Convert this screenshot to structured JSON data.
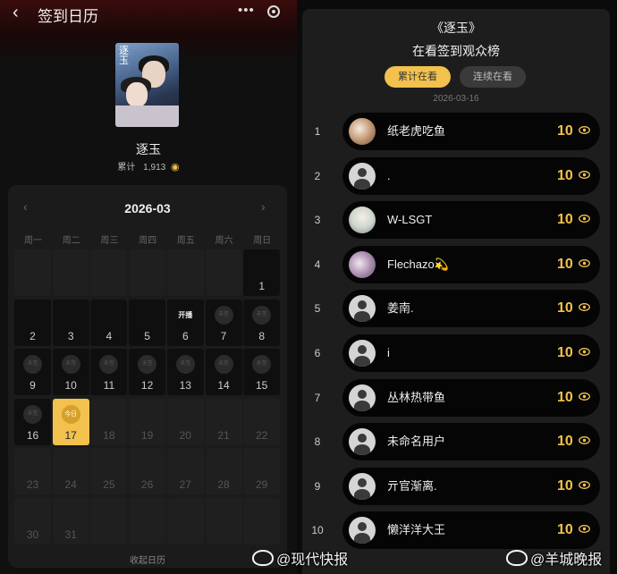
{
  "header": {
    "back_icon": "chevron-left-icon",
    "title": "签到日历",
    "more_icon": "more-dots-icon",
    "target_icon": "target-icon"
  },
  "drama": {
    "name": "逐玉",
    "poster_title": "逐玉",
    "cumulative_label": "累计",
    "cumulative_value": "1,913",
    "eye_icon": "eye-icon"
  },
  "calendar": {
    "month": "2026-03",
    "prev_icon": "chevron-left-icon",
    "next_icon": "chevron-right-icon",
    "weekdays": [
      "周一",
      "周二",
      "周三",
      "周四",
      "周五",
      "周六",
      "周日"
    ],
    "days": [
      {
        "day": "1",
        "badge": "",
        "tag": ""
      },
      {
        "day": "2",
        "badge": "",
        "tag": ""
      },
      {
        "day": "3",
        "badge": "",
        "tag": ""
      },
      {
        "day": "4",
        "badge": "",
        "tag": ""
      },
      {
        "day": "5",
        "badge": "",
        "tag": ""
      },
      {
        "day": "6",
        "badge": "",
        "tag": "开播"
      },
      {
        "day": "7",
        "badge": "未签",
        "tag": ""
      },
      {
        "day": "8",
        "badge": "未签",
        "tag": ""
      },
      {
        "day": "9",
        "badge": "未签",
        "tag": ""
      },
      {
        "day": "10",
        "badge": "未签",
        "tag": ""
      },
      {
        "day": "11",
        "badge": "未签",
        "tag": ""
      },
      {
        "day": "12",
        "badge": "未签",
        "tag": ""
      },
      {
        "day": "13",
        "badge": "未签",
        "tag": ""
      },
      {
        "day": "14",
        "badge": "未签",
        "tag": ""
      },
      {
        "day": "15",
        "badge": "未签",
        "tag": ""
      },
      {
        "day": "16",
        "badge": "未签",
        "tag": ""
      },
      {
        "day": "17",
        "badge": "今日",
        "tag": ""
      },
      {
        "day": "18",
        "badge": "",
        "tag": ""
      },
      {
        "day": "19",
        "badge": "",
        "tag": ""
      },
      {
        "day": "20",
        "badge": "",
        "tag": ""
      },
      {
        "day": "21",
        "badge": "",
        "tag": ""
      },
      {
        "day": "22",
        "badge": "",
        "tag": ""
      },
      {
        "day": "23",
        "badge": "",
        "tag": ""
      },
      {
        "day": "24",
        "badge": "",
        "tag": ""
      },
      {
        "day": "25",
        "badge": "",
        "tag": ""
      },
      {
        "day": "26",
        "badge": "",
        "tag": ""
      },
      {
        "day": "27",
        "badge": "",
        "tag": ""
      },
      {
        "day": "28",
        "badge": "",
        "tag": ""
      },
      {
        "day": "29",
        "badge": "",
        "tag": ""
      },
      {
        "day": "30",
        "badge": "",
        "tag": ""
      },
      {
        "day": "31",
        "badge": "",
        "tag": ""
      }
    ],
    "today": "17",
    "collapse_label": "收起日历"
  },
  "leaderboard": {
    "title": "《逐玉》",
    "subtitle": "在看签到观众榜",
    "tabs": [
      {
        "label": "累计在看",
        "active": true
      },
      {
        "label": "连续在看",
        "active": false
      }
    ],
    "date": "2026-03-16",
    "rows": [
      {
        "rank": "1",
        "name": "纸老虎吃鱼",
        "count": "10",
        "avatar": "photo1"
      },
      {
        "rank": "2",
        "name": ".",
        "count": "10",
        "avatar": "default"
      },
      {
        "rank": "3",
        "name": "W-LSGT",
        "count": "10",
        "avatar": "photo2"
      },
      {
        "rank": "4",
        "name": "Flechazo💫",
        "count": "10",
        "avatar": "photo3"
      },
      {
        "rank": "5",
        "name": "姜南.",
        "count": "10",
        "avatar": "default"
      },
      {
        "rank": "6",
        "name": "i",
        "count": "10",
        "avatar": "default"
      },
      {
        "rank": "7",
        "name": "丛林热带鱼",
        "count": "10",
        "avatar": "default"
      },
      {
        "rank": "8",
        "name": "未命名用户",
        "count": "10",
        "avatar": "default"
      },
      {
        "rank": "9",
        "name": "亓官渐离.",
        "count": "10",
        "avatar": "default"
      },
      {
        "rank": "10",
        "name": "懒洋洋大王",
        "count": "10",
        "avatar": "default"
      }
    ]
  },
  "watermarks": [
    {
      "text": "@现代快报",
      "icon": "weibo-icon"
    },
    {
      "text": "@羊城晚报",
      "icon": "weibo-icon"
    }
  ],
  "colors": {
    "accent": "#f2c14e",
    "panel": "#1d1d1d",
    "pill": "#050505"
  }
}
